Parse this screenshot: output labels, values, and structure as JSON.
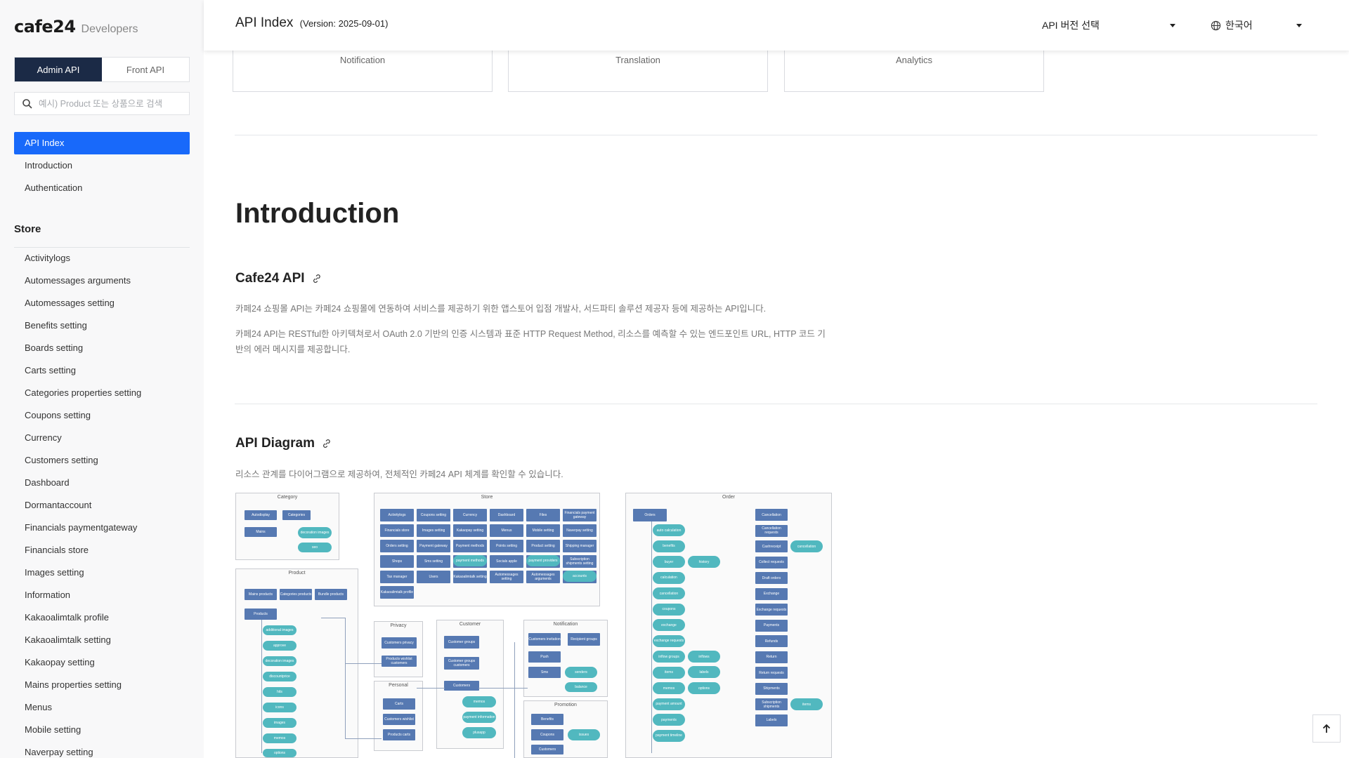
{
  "sidebar": {
    "logo": "cafe24",
    "logo_sub": "Developers",
    "tabs": [
      {
        "label": "Admin API",
        "active": true
      },
      {
        "label": "Front API",
        "active": false
      }
    ],
    "search_placeholder": "예시) Product 또는 상품으로 검색",
    "nav": [
      {
        "label": "API Index",
        "active": true
      },
      {
        "label": "Introduction",
        "active": false
      },
      {
        "label": "Authentication",
        "active": false
      }
    ],
    "section_title": "Store",
    "store_items": [
      "Activitylogs",
      "Automessages arguments",
      "Automessages setting",
      "Benefits setting",
      "Boards setting",
      "Carts setting",
      "Categories properties setting",
      "Coupons setting",
      "Currency",
      "Customers setting",
      "Dashboard",
      "Dormantaccount",
      "Financials paymentgateway",
      "Financials store",
      "Images setting",
      "Information",
      "Kakaoalimtalk profile",
      "Kakaoalimtalk setting",
      "Kakaopay setting",
      "Mains properties setting",
      "Menus",
      "Mobile setting",
      "Naverpay setting"
    ]
  },
  "header": {
    "title": "API Index",
    "version": "(Version: 2025-09-01)",
    "version_select": "API 버전 선택",
    "language": "한국어"
  },
  "categories": [
    "Notification",
    "Translation",
    "Analytics"
  ],
  "intro": {
    "title": "Introduction",
    "cafe24_api_title": "Cafe24 API",
    "para1": "카페24 쇼핑몰 API는 카페24 쇼핑몰에 연동하여 서비스를 제공하기 위한 앱스토어 입점 개발사, 서드파티 솔루션 제공자 등에 제공하는 API입니다.",
    "para2": "카페24 API는 RESTful한 아키텍쳐로서 OAuth 2.0 기반의 인증 시스템과 표준 HTTP Request Method, 리소스를 예측할 수 있는 엔드포인트 URL, HTTP 코드 기반의 에러 메시지를 제공합니다.",
    "diagram_title": "API Diagram",
    "diagram_desc": "리소스 관계를 다이어그램으로 제공하여, 전체적인 카페24 API 체계를 확인할 수 있습니다."
  },
  "diagram": {
    "category": {
      "title": "Category",
      "nodes": [
        "Autodisplay",
        "Categories",
        "Mains"
      ],
      "leaves": [
        "decoration images",
        "seo"
      ]
    },
    "product": {
      "title": "Product",
      "nodes": [
        "Mains products",
        "Categories products",
        "Bundle products",
        "Products"
      ],
      "leaves": [
        "additional images",
        "approve",
        "decoration images",
        "discountprice",
        "hits",
        "icons",
        "images",
        "memos",
        "options"
      ]
    },
    "store": {
      "title": "Store",
      "nodes": [
        "Activitylogs",
        "Coupons setting",
        "Currency",
        "Dashboard",
        "Files",
        "Financials payment gateway",
        "Financials store",
        "Images setting",
        "Kakaopay setting",
        "Menus",
        "Mobile setting",
        "Naverpay setting",
        "Orders setting",
        "Payment gateway",
        "Payment methods",
        "Points setting",
        "Product setting",
        "Shipping manager",
        "Shops",
        "Sms setting",
        "Store",
        "Socials apple",
        "Socials naverlogin",
        "Subscription shipments setting",
        "Tax manager",
        "Users",
        "Kakaoalimtalk setting",
        "Automessages setting",
        "Automessages arguments",
        "Redirects",
        "Kakaoalimtalk profile"
      ],
      "leaves": [
        "payment methods",
        "payment providers",
        "accounts"
      ]
    },
    "privacy": {
      "title": "Privacy",
      "nodes": [
        "Customers privacy",
        "Products wishlist customers"
      ]
    },
    "personal": {
      "title": "Personal",
      "nodes": [
        "Carts",
        "Customers wishlist",
        "Products carts"
      ]
    },
    "customer": {
      "title": "Customer",
      "nodes": [
        "Customer groups",
        "Customer groups customers",
        "Customers"
      ],
      "leaves": [
        "memos",
        "payment information",
        "plusapp"
      ]
    },
    "notification": {
      "title": "Notification",
      "nodes": [
        "Customers invitation",
        "Recipient groups",
        "Push",
        "Sms"
      ],
      "leaves": [
        "senders",
        "balance"
      ]
    },
    "promotion": {
      "title": "Promotion",
      "nodes": [
        "Benefits",
        "Coupons",
        "Customers"
      ],
      "leaves": [
        "issues"
      ]
    },
    "order": {
      "title": "Order",
      "nodes": [
        "Orders",
        "Cancellation",
        "Cancellation requests",
        "Cashreceipt",
        "Collect requests",
        "Draft orders",
        "Exchange",
        "Exchange requests",
        "Payments",
        "Refunds",
        "Return",
        "Return requests",
        "Shipments",
        "Subscription shipments",
        "Labels"
      ],
      "leaves": [
        "auto calculation",
        "benefits",
        "buyer",
        "calculation",
        "cancellation",
        "coupons",
        "exchange",
        "exchange requests",
        "inflow groups",
        "items",
        "memos",
        "payment amount",
        "payments",
        "payment timeline",
        "history",
        "inflows",
        "labels",
        "options",
        "cancellation",
        "items"
      ]
    }
  },
  "back_to_top": "top"
}
